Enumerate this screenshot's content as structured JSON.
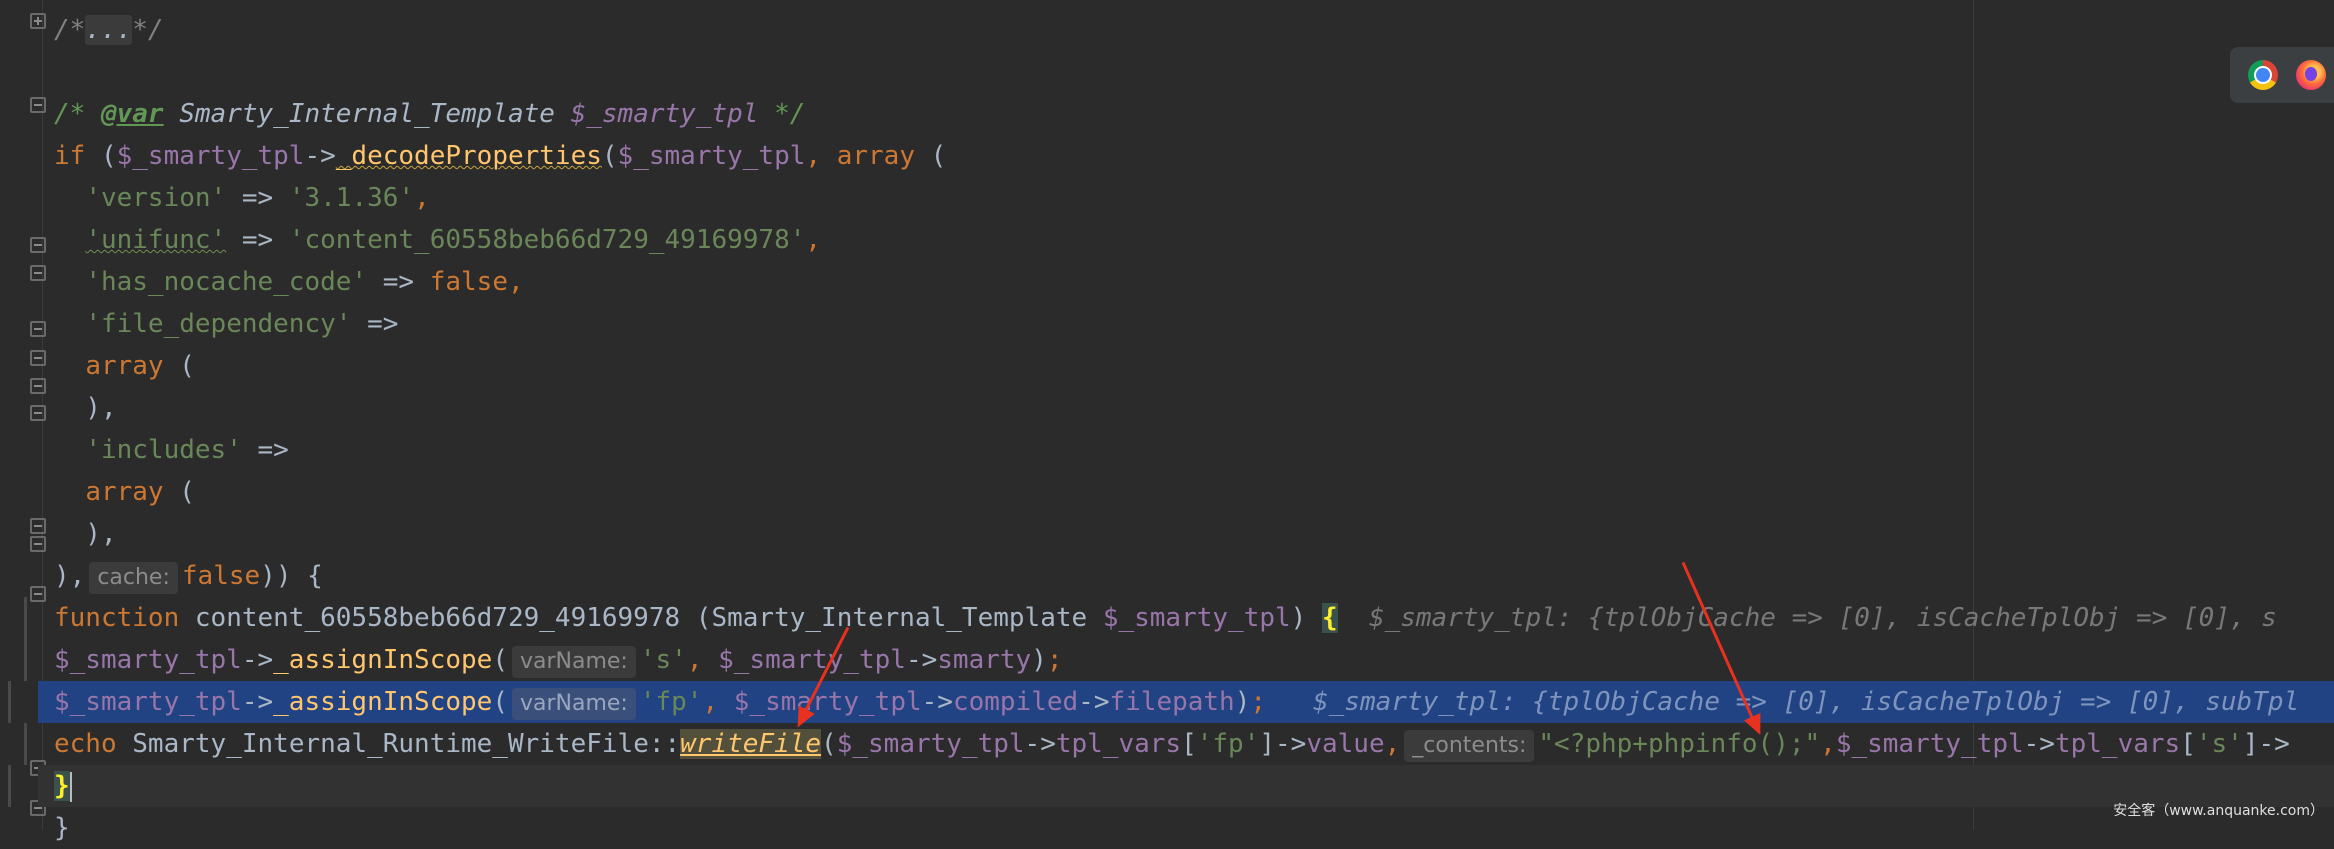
{
  "code": {
    "line_fold": "/*...*/",
    "line_doc": "/* @var Smarty_Internal_Template $_smarty_tpl */",
    "if_kw": "if",
    "var_tpl": "$_smarty_tpl",
    "arrow": "->",
    "decode_props": "_decodeProperties",
    "array_kw": "array",
    "version_key": "'version'",
    "version_val": "'3.1.36'",
    "unifunc_key": "'unifunc'",
    "unifunc_val": "'content_60558beb66d729_49169978'",
    "nocache_key": "'has_nocache_code'",
    "false_kw": "false",
    "filedep_key": "'file_dependency'",
    "includes_key": "'includes'",
    "function_kw": "function",
    "func_name": "content_60558beb66d729_49169978",
    "type_name": "Smarty_Internal_Template",
    "assign_fn": "_assignInScope",
    "s_str": "'s'",
    "smarty_prop": "smarty",
    "fp_str": "'fp'",
    "compiled_prop": "compiled",
    "filepath_prop": "filepath",
    "echo_kw": "echo",
    "writefile_class": "Smarty_Internal_Runtime_WriteFile",
    "writefile_fn": "writeFile",
    "tpl_vars": "tpl_vars",
    "value_prop": "value",
    "payload_str": "\"<?php+phpinfo();\"",
    "close_brace": "}"
  },
  "hints": {
    "cache": "cache:",
    "varName": "varName:",
    "contents": "_contents:"
  },
  "debug": {
    "line18": "$_smarty_tpl: {tplObjCache => [0], isCacheTplObj => [0], s",
    "line20": "$_smarty_tpl: {tplObjCache => [0], isCacheTplObj => [0], subTpl"
  },
  "watermark": "安全客（www.anquanke.com）",
  "icons": [
    "chrome-icon",
    "firefox-icon"
  ],
  "colors": {
    "background": "#2b2b2b",
    "keyword": "#cc7832",
    "string": "#6a8759",
    "variable": "#9876aa",
    "function": "#ffc66d",
    "selection": "#214283",
    "annotation_arrow": "#e8311e"
  }
}
